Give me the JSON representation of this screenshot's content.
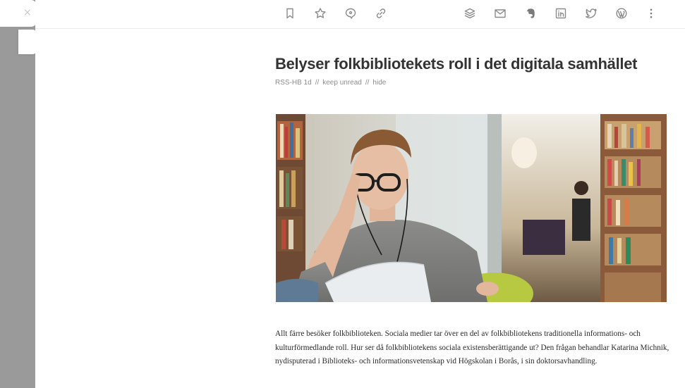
{
  "toolbar": {
    "close_glyph": "×",
    "left_icons": [
      "bookmark-icon",
      "star-icon",
      "tag-icon",
      "link-icon"
    ],
    "right_icons": [
      "layers-icon",
      "mail-icon",
      "evernote-icon",
      "linkedin-icon",
      "twitter-icon",
      "wordpress-icon",
      "more-icon"
    ]
  },
  "article": {
    "title": "Belyser folkbibliotekets roll i det digitala samhället",
    "source": "RSS-HB 1d",
    "separator": "//",
    "keep_unread": "keep unread",
    "hide": "hide",
    "body": "Allt färre besöker folkbiblioteken. Sociala medier tar över en del av folkbibliotekens traditionella informations- och kulturförmedlande roll. Hur ser då folkbibliotekens sociala existensberättigande ut? Den frågan behandlar Katarina Michnik, nydisputerad i Biblioteks- och informationsvetenskap vid Högskolan i Borås, i sin doktorsavhandling."
  },
  "colors": {
    "rail": "#9a9a9a",
    "title": "#333333",
    "meta": "#8c8c8c",
    "icon": "#8a8a8a"
  }
}
